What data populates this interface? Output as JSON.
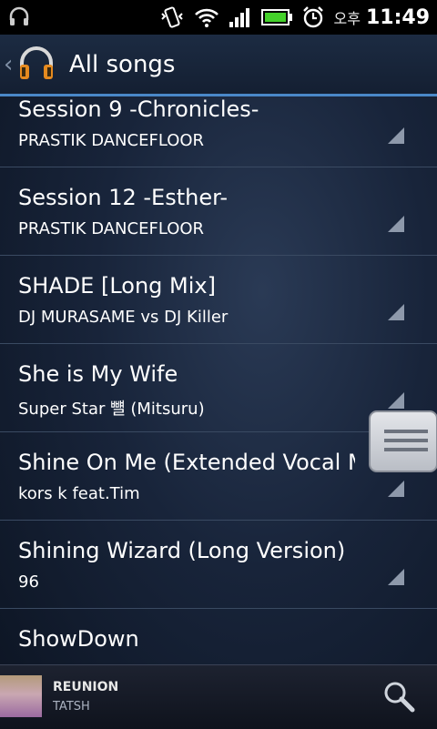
{
  "status_bar": {
    "ampm": "오후",
    "time": "11:49",
    "icons": [
      "headphones-icon",
      "vibrate-icon",
      "wifi-icon",
      "signal-icon",
      "battery-icon",
      "alarm-icon"
    ]
  },
  "header": {
    "title": "All songs",
    "icon": "headphones-app-icon"
  },
  "songs": [
    {
      "title": "Session 9 -Chronicles-",
      "artist": "PRASTIK DANCEFLOOR"
    },
    {
      "title": "Session 12 -Esther-",
      "artist": "PRASTIK DANCEFLOOR"
    },
    {
      "title": "SHADE [Long Mix]",
      "artist": "DJ MURASAME vs DJ Killer"
    },
    {
      "title": "She is My Wife",
      "artist": "Super Star 뺼 (Mitsuru)"
    },
    {
      "title": "Shine On Me (Extended Vocal M",
      "artist": "kors k feat.Tim"
    },
    {
      "title": "Shining Wizard (Long Version)",
      "artist": "96"
    },
    {
      "title": "ShowDown",
      "artist": ""
    }
  ],
  "now_playing": {
    "title": "REUNION",
    "artist": "TATSH"
  },
  "colors": {
    "accent": "#4a88c8",
    "background": "#18243a"
  }
}
